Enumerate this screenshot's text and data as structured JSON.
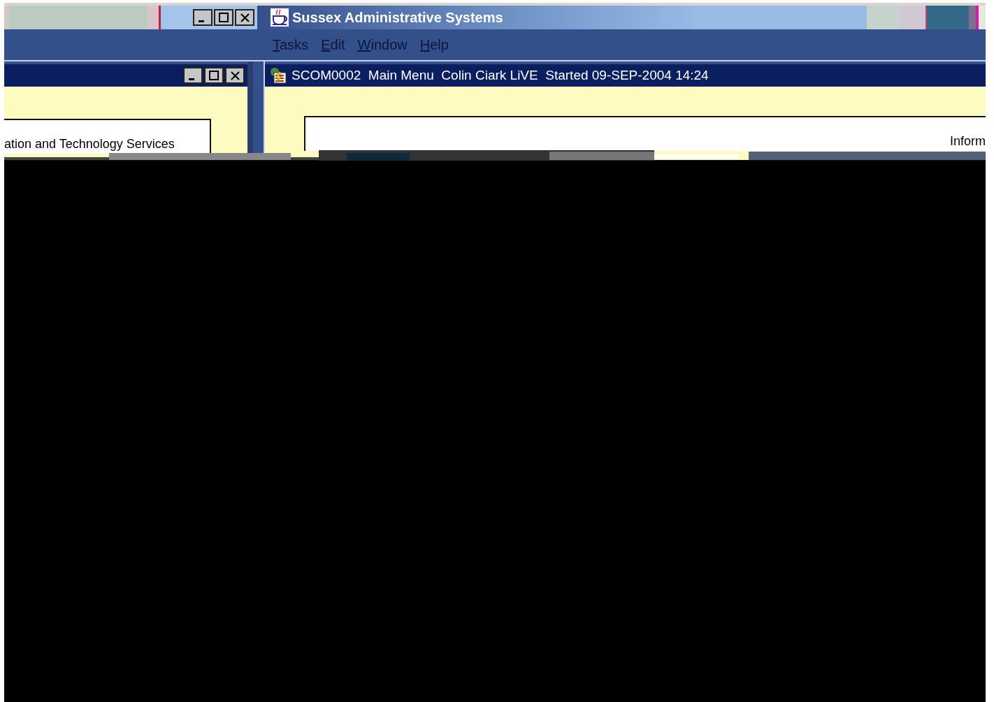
{
  "app_window": {
    "title": "Sussex Administrative Systems"
  },
  "menu": [
    {
      "label": "Tasks"
    },
    {
      "label": "Edit"
    },
    {
      "label": "Window"
    },
    {
      "label": "Help"
    }
  ],
  "left_window": {
    "panel_text": "ation and Technology Services"
  },
  "main_window": {
    "title": "SCOM0002  Main Menu  Colin Ciark LiVE  Started 09-SEP-2004 14:24",
    "panel_text": "Inform"
  }
}
